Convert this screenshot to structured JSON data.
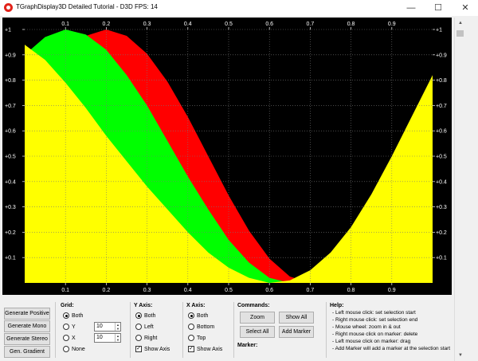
{
  "window": {
    "title": "TGraphDisplay3D Detailed Tutorial - D3D FPS: 14",
    "icon": "app-circle-icon",
    "minimize_glyph": "—",
    "maximize_glyph": "☐",
    "close_glyph": "✕"
  },
  "chart_data": {
    "type": "area",
    "x_ticks": [
      "0.1",
      "0.2",
      "0.3",
      "0.4",
      "0.5",
      "0.6",
      "0.7",
      "0.8",
      "0.9"
    ],
    "y_ticks": [
      "+0.1",
      "+0.2",
      "+0.3",
      "+0.4",
      "+0.5",
      "+0.6",
      "+0.7",
      "+0.8",
      "+0.9",
      "+1"
    ],
    "xlim": [
      0,
      1
    ],
    "ylim": [
      0,
      1
    ],
    "background": "#000000",
    "grid": true,
    "series": [
      {
        "color": "#ff0000",
        "x": [
          0,
          0.05,
          0.1,
          0.15,
          0.2,
          0.25,
          0.3,
          0.35,
          0.4,
          0.45,
          0.5,
          0.55,
          0.6,
          0.65,
          0.7,
          0.75,
          0.8,
          0.85,
          0.9,
          0.95,
          1.0
        ],
        "y": [
          0.655,
          0.794,
          0.904,
          0.975,
          1.0,
          0.975,
          0.904,
          0.794,
          0.655,
          0.5,
          0.345,
          0.206,
          0.096,
          0.025,
          0.0,
          0.025,
          0.096,
          0.206,
          0.345,
          0.5,
          0.655
        ]
      },
      {
        "color": "#00ff00",
        "x": [
          0,
          0.05,
          0.1,
          0.15,
          0.2,
          0.25,
          0.3,
          0.35,
          0.4,
          0.45,
          0.5,
          0.55,
          0.6,
          0.65,
          0.7,
          0.75,
          0.8,
          0.85,
          0.9,
          0.95,
          1.0
        ],
        "y": [
          0.9,
          0.97,
          1.0,
          0.98,
          0.92,
          0.82,
          0.7,
          0.56,
          0.42,
          0.29,
          0.17,
          0.08,
          0.02,
          0.0,
          0.02,
          0.08,
          0.17,
          0.29,
          0.42,
          0.56,
          0.7
        ]
      },
      {
        "color": "#ffff00",
        "x": [
          0,
          0.05,
          0.1,
          0.15,
          0.2,
          0.25,
          0.3,
          0.35,
          0.4,
          0.45,
          0.5,
          0.55,
          0.6,
          0.65,
          0.7,
          0.75,
          0.8,
          0.85,
          0.9,
          0.95,
          1.0
        ],
        "y": [
          0.94,
          0.88,
          0.79,
          0.69,
          0.58,
          0.48,
          0.38,
          0.29,
          0.2,
          0.12,
          0.06,
          0.02,
          0.0,
          0.01,
          0.05,
          0.12,
          0.22,
          0.35,
          0.5,
          0.66,
          0.82
        ]
      }
    ]
  },
  "buttons": {
    "generate_positive": "Generate Positive",
    "generate_mono": "Generate Mono",
    "generate_stereo": "Generate Stereo",
    "gen_gradient": "Gen. Gradient"
  },
  "grid_group": {
    "label": "Grid:",
    "options": [
      "Both",
      "Y",
      "X",
      "None"
    ],
    "selected": "Both",
    "y_value": "10",
    "x_value": "10"
  },
  "y_axis_group": {
    "label": "Y Axis:",
    "options": [
      "Both",
      "Left",
      "Right"
    ],
    "selected": "Both",
    "show_axis_label": "Show Axis",
    "show_axis_checked": true
  },
  "x_axis_group": {
    "label": "X Axis:",
    "options": [
      "Both",
      "Bottom",
      "Top"
    ],
    "selected": "Both",
    "show_axis_label": "Show Axis",
    "show_axis_checked": true
  },
  "commands": {
    "label": "Commands:",
    "zoom": "Zoom",
    "show_all": "Show All",
    "select_all": "Select All",
    "add_marker": "Add Marker"
  },
  "marker": {
    "label": "Marker:"
  },
  "help": {
    "label": "Help:",
    "lines": [
      "- Left mouse click: set selection start",
      "- Right mouse click: set selection end",
      "- Mouse wheel: zoom in & out",
      "- Right mouse click on marker: delete",
      "- Left mouse click on marker: drag",
      "- Add Marker will add a marker at the selection start"
    ]
  }
}
